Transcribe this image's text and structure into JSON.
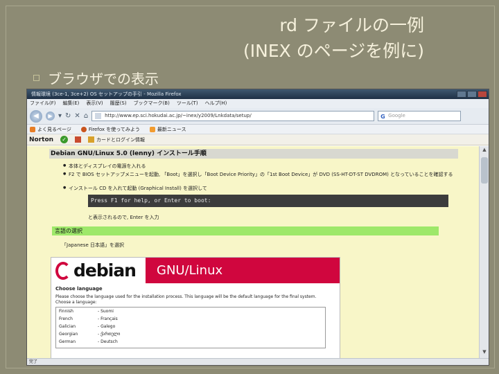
{
  "slide": {
    "title_line1": "rd ファイルの一例",
    "title_line2": "(INEX のページを例に)",
    "bullet_text": "ブラウザでの表示"
  },
  "browser": {
    "window_title": "情報環境 (3ce-1, 3ce+2) OS セットアップの手引 - Mozilla Firefox",
    "menu": [
      "ファイル(F)",
      "編集(E)",
      "表示(V)",
      "履歴(S)",
      "ブックマーク(B)",
      "ツール(T)",
      "ヘルプ(H)"
    ],
    "url": "http://www.ep.sci.hokudai.ac.jp/~inex/y2009/Lnkdata/setup/",
    "search_placeholder": "Google",
    "bookmarks": [
      "よく見るページ",
      "Firefox を使ってみよう",
      "最新ニュース"
    ],
    "norton": {
      "brand": "Norton",
      "item": "カードとログイン情報"
    },
    "status": "完了"
  },
  "page": {
    "doc_title": "Debian GNU/Linux 5.0 (lenny) インストール手順",
    "items": [
      "本体とディスプレイの電源を入れる",
      "F2 で BIOS セットアップメニューを起動, 「Boot」を選択し「Boot Device Priority」の「1st Boot Device」が DVD (SS-HT-DT-ST DVDROM) となっていることを確認する",
      "インストール CD を入れて起動 (Graphical Install) を選択して"
    ],
    "console_text": "Press F1 for help, or Enter to boot:",
    "note": "と表示されるので, Enter を入力",
    "section_title": "言語の選択",
    "section_text": "「Japanese 日本語」を選択",
    "installer": {
      "logo_text": "debian",
      "product": "GNU/Linux",
      "heading": "Choose language",
      "description": "Please choose the language used for the installation process. This language will be the default language for the final system.",
      "prompt": "Choose a language:",
      "languages": [
        {
          "en": "Finnish",
          "native": "- Suomi"
        },
        {
          "en": "French",
          "native": "- Français"
        },
        {
          "en": "Galician",
          "native": "- Galego"
        },
        {
          "en": "Georgian",
          "native": "- ქართული"
        },
        {
          "en": "German",
          "native": "- Deutsch"
        }
      ]
    }
  }
}
